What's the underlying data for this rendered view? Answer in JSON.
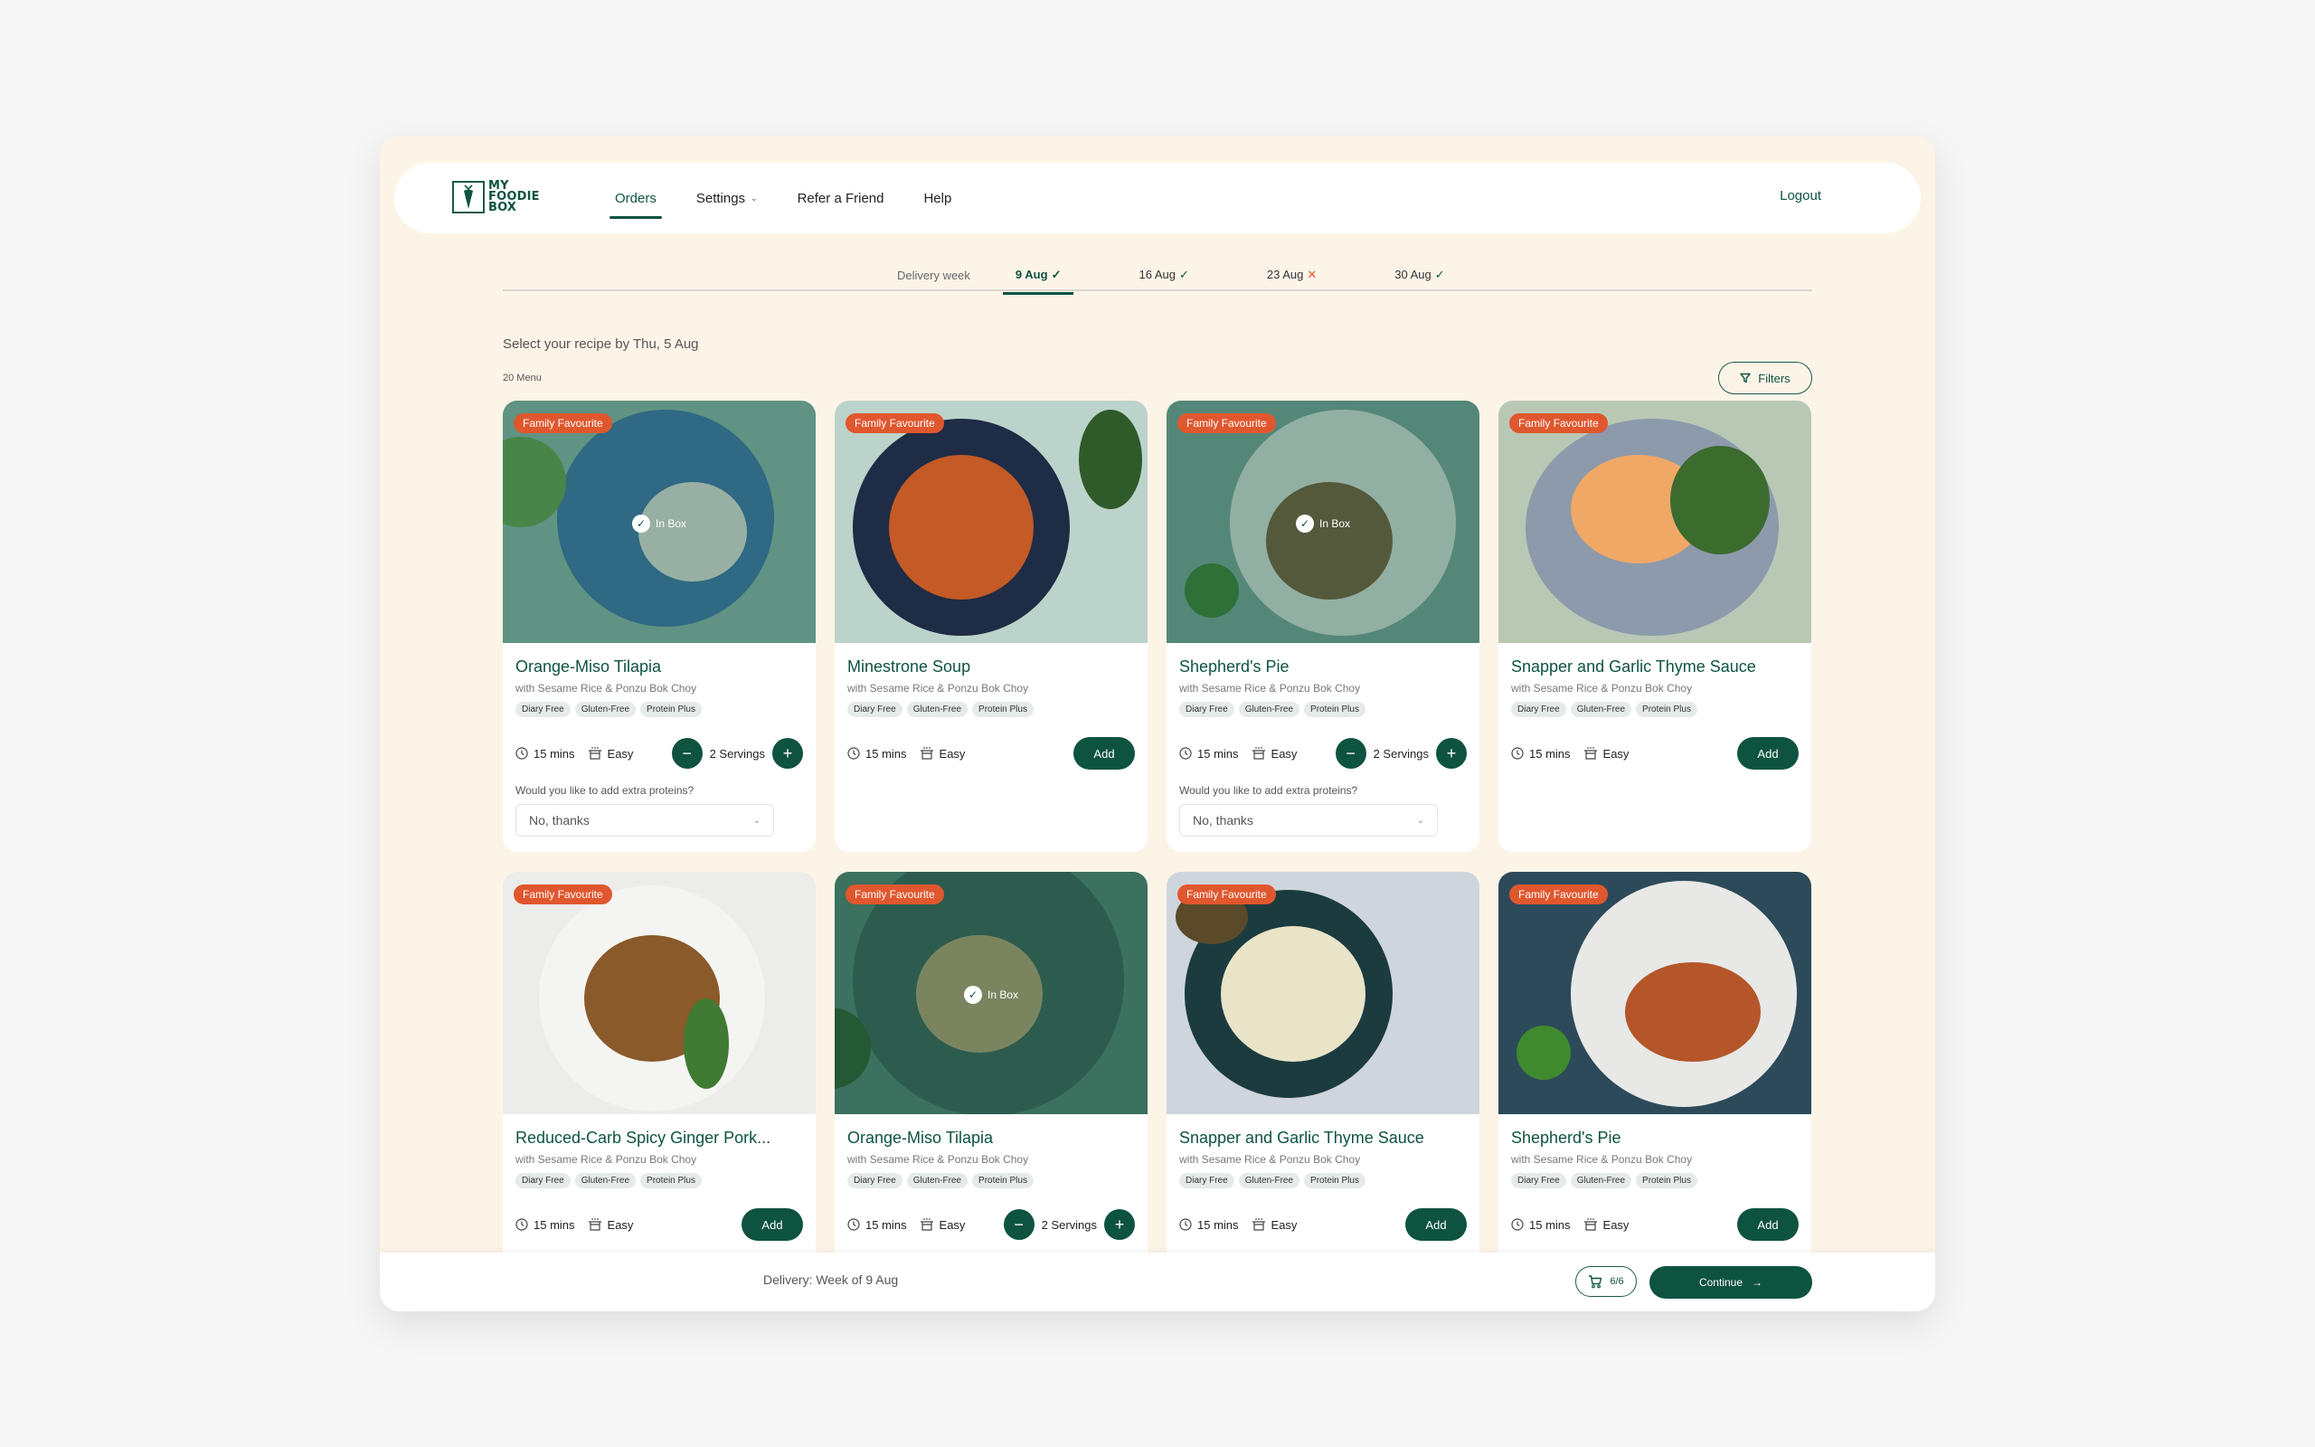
{
  "brand": {
    "logo_text": [
      "MY",
      "FOODIE",
      "BOX"
    ]
  },
  "nav": {
    "items": [
      {
        "label": "Orders",
        "active": true
      },
      {
        "label": "Settings",
        "dropdown": true
      },
      {
        "label": "Refer a Friend"
      },
      {
        "label": "Help"
      }
    ],
    "logout": "Logout"
  },
  "weeks": {
    "label": "Delivery week",
    "tabs": [
      {
        "label": "9 Aug",
        "status": "confirmed",
        "active": true
      },
      {
        "label": "16 Aug",
        "status": "confirmed"
      },
      {
        "label": "23 Aug",
        "status": "skipped"
      },
      {
        "label": "30 Aug",
        "status": "confirmed"
      }
    ],
    "status_icons": {
      "confirmed": "✓",
      "skipped": "✕"
    }
  },
  "menu": {
    "select_by": "Select your recipe by Thu, 5 Aug",
    "count": "20 Menu",
    "filters_label": "Filters"
  },
  "labels": {
    "badge": "Family Favourite",
    "in_box": "In Box",
    "add": "Add",
    "extra_question": "Would you like to add extra proteins?",
    "extra_default": "No, thanks"
  },
  "recipes": [
    {
      "title": "Orange-Miso Tilapia",
      "subtitle": "with Sesame Rice & Ponzu Bok Choy",
      "tags": [
        "Diary Free",
        "Gluten-Free",
        "Protein Plus"
      ],
      "time": "15 mins",
      "difficulty": "Easy",
      "in_box": true,
      "servings": "2 Servings",
      "extra_protein": "No, thanks"
    },
    {
      "title": "Minestrone Soup",
      "subtitle": "with Sesame Rice & Ponzu Bok Choy",
      "tags": [
        "Diary Free",
        "Gluten-Free",
        "Protein Plus"
      ],
      "time": "15 mins",
      "difficulty": "Easy",
      "in_box": false
    },
    {
      "title": "Shepherd's Pie",
      "subtitle": "with Sesame Rice & Ponzu Bok Choy",
      "tags": [
        "Diary Free",
        "Gluten-Free",
        "Protein Plus"
      ],
      "time": "15 mins",
      "difficulty": "Easy",
      "in_box": true,
      "servings": "2 Servings",
      "extra_protein": "No, thanks"
    },
    {
      "title": "Snapper and Garlic Thyme Sauce",
      "subtitle": "with Sesame Rice & Ponzu Bok Choy",
      "tags": [
        "Diary Free",
        "Gluten-Free",
        "Protein Plus"
      ],
      "time": "15 mins",
      "difficulty": "Easy",
      "in_box": false
    },
    {
      "title": "Reduced-Carb Spicy Ginger Pork...",
      "subtitle": "with Sesame Rice & Ponzu Bok Choy",
      "tags": [
        "Diary Free",
        "Gluten-Free",
        "Protein Plus"
      ],
      "time": "15 mins",
      "difficulty": "Easy",
      "in_box": false
    },
    {
      "title": "Orange-Miso Tilapia",
      "subtitle": "with Sesame Rice & Ponzu Bok Choy",
      "tags": [
        "Diary Free",
        "Gluten-Free",
        "Protein Plus"
      ],
      "time": "15 mins",
      "difficulty": "Easy",
      "in_box": true,
      "servings": "2 Servings"
    },
    {
      "title": "Snapper and Garlic Thyme Sauce",
      "subtitle": "with Sesame Rice & Ponzu Bok Choy",
      "tags": [
        "Diary Free",
        "Gluten-Free",
        "Protein Plus"
      ],
      "time": "15 mins",
      "difficulty": "Easy",
      "in_box": false
    },
    {
      "title": "Shepherd's Pie",
      "subtitle": "with Sesame Rice & Ponzu Bok Choy",
      "tags": [
        "Diary Free",
        "Gluten-Free",
        "Protein Plus"
      ],
      "time": "15 mins",
      "difficulty": "Easy",
      "in_box": false
    }
  ],
  "photo_palettes": [
    {
      "bg": "#8fb7a8",
      "plate": "#3f73a8",
      "food": "#e8e6dc",
      "accent": "#6aa04a"
    },
    {
      "bg": "#bcd3cb",
      "plate": "#1f2c45",
      "food": "#c45a25",
      "accent": "#2f5a2a"
    },
    {
      "bg": "#7da497",
      "plate": "#dfe4dc",
      "food": "#7b5a34",
      "accent": "#3f7f2f"
    },
    {
      "bg": "#b9c8b5",
      "plate": "#8d9aab",
      "food": "#f0a866",
      "accent": "#3c6b2e"
    },
    {
      "bg": "#ececea",
      "plate": "#f4f4f2",
      "food": "#8a5a2a",
      "accent": "#3f7b33"
    },
    {
      "bg": "#557f6f",
      "plate": "#3d5e54",
      "food": "#b8a070",
      "accent": "#2f5a2a"
    },
    {
      "bg": "#cfd5dc",
      "plate": "#1c3b3f",
      "food": "#e9e3c8",
      "accent": "#5a4a2a"
    },
    {
      "bg": "#2d4a5a",
      "plate": "#e8e8e6",
      "food": "#b5562a",
      "accent": "#3f8a2f"
    }
  ],
  "footer": {
    "delivery": "Delivery: Week of 9 Aug",
    "cart_count": "6/6",
    "continue": "Continue"
  }
}
